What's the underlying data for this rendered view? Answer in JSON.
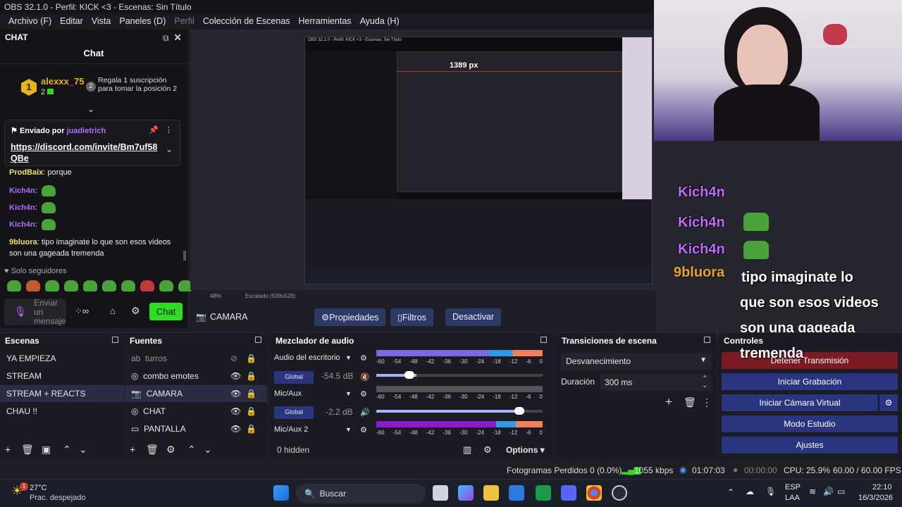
{
  "window": {
    "title": "OBS 32.1.0 - Perfil: KICK <3 - Escenas: Sin Título"
  },
  "menu": [
    {
      "label": "Archivo (F)",
      "disabled": false
    },
    {
      "label": "Editar",
      "disabled": false
    },
    {
      "label": "Vista",
      "disabled": false
    },
    {
      "label": "Paneles (D)",
      "disabled": false
    },
    {
      "label": "Perfil",
      "disabled": true
    },
    {
      "label": "Colección de Escenas",
      "disabled": false
    },
    {
      "label": "Herramientas",
      "disabled": false
    },
    {
      "label": "Ayuda (H)",
      "disabled": false
    }
  ],
  "chat": {
    "dock_title": "CHAT",
    "title": "Chat",
    "leader": {
      "rank": "1",
      "name": "alexxx_75",
      "count": "2",
      "rank2": "2",
      "promo": "Regala 1 suscripción para tomar la posición 2"
    },
    "pinned": {
      "label": "Enviado por",
      "user": "juadietrich",
      "link": "https://discord.com/invite/Bm7uf58QBe",
      "link_line1": "https://discord.com/invite/Bm7uf58",
      "link_line2": "QBe"
    },
    "messages": [
      {
        "user": "ProdBaix",
        "text": "porque"
      },
      {
        "user": "Kich4n",
        "text": ""
      },
      {
        "user": "Kich4n",
        "text": ""
      },
      {
        "user": "Kich4n",
        "text": ""
      },
      {
        "user": "9bluora",
        "text": "tipo imaginate lo que son esos videos son una gageada tremenda"
      }
    ],
    "msg5_line1": "tipo imaginate lo que son esos videos",
    "msg5_line2": "son una gageada tremenda",
    "followers": "Solo seguidores",
    "input_placeholder": "Enviar un mensaje",
    "send_label": "Chat"
  },
  "preview": {
    "inner_title": "OBS 32.1.0 - Perfil: KICK <3 - Escenas: Sin Título",
    "px_label": "1389 px",
    "zoom": "48%",
    "scale": "Escalado (939x528)"
  },
  "overlay": {
    "kich_name": "Kich4n",
    "msg_user": "9bluora",
    "msg_lines": [
      "tipo imaginate lo",
      "que son esos videos",
      "son una gageada",
      "tremenda"
    ]
  },
  "source_bar": {
    "source": "CAMARA",
    "properties": "Propiedades",
    "filters": "Filtros",
    "deactivate": "Desactivar"
  },
  "scenes": {
    "title": "Escenas",
    "items": [
      {
        "label": "YA EMPIEZA",
        "selected": false
      },
      {
        "label": "STREAM",
        "selected": false
      },
      {
        "label": "STREAM + REACTS",
        "selected": true
      },
      {
        "label": "CHAU !!",
        "selected": false
      }
    ]
  },
  "sources": {
    "title": "Fuentes",
    "items": [
      {
        "label": "turros",
        "icon": "text-icon",
        "hidden": true
      },
      {
        "label": "combo emotes",
        "icon": "browser-icon",
        "hidden": false
      },
      {
        "label": "CAMARA",
        "icon": "camera-icon",
        "hidden": false
      },
      {
        "label": "CHAT",
        "icon": "browser-icon",
        "hidden": false
      },
      {
        "label": "PANTALLA",
        "icon": "display-icon",
        "hidden": false
      }
    ]
  },
  "mixer": {
    "title": "Mezclador de audio",
    "channels": [
      {
        "name": "Audio del escritorio",
        "track": "Global",
        "db": "-54.5 dB",
        "muted": true
      },
      {
        "name": "Mic/Aux",
        "track": "Global",
        "db": "-2.2 dB",
        "muted": false
      },
      {
        "name": "Mic/Aux 2",
        "track": "",
        "db": "",
        "muted": false
      }
    ],
    "ticks": [
      "-60",
      "-54",
      "-48",
      "-42",
      "-36",
      "-30",
      "-24",
      "-18",
      "-12",
      "-6",
      "0"
    ],
    "hidden": "0 hidden",
    "options": "Options"
  },
  "transitions": {
    "title": "Transiciones de escena",
    "selected": "Desvanecimiento",
    "duration_label": "Duración",
    "duration": "300 ms"
  },
  "controls": {
    "title": "Controles",
    "buttons": [
      "Detener Transmisión",
      "Iniciar Grabación",
      "Iniciar Cámara Virtual",
      "Modo Estudio",
      "Ajustes"
    ]
  },
  "status": {
    "dropped": "Fotogramas Perdidos 0 (0.0%)",
    "kbps": "1055 kbps",
    "stream_time": "01:07:03",
    "rec_time": "00:00:00",
    "cpu": "CPU: 25.9%",
    "fps": "60.00 / 60.00 FPS"
  },
  "taskbar": {
    "temp": "27°C",
    "weather": "Prac. despejado",
    "badge": "1",
    "search": "Buscar",
    "lang1": "ESP",
    "lang2": "LAA",
    "time": "22:10",
    "date": "16/3/2026"
  },
  "colors": {
    "accent": "#2a3580",
    "kick_green": "#2fdc24",
    "selected_scene": "#2a2c45",
    "kich_purple": "#c06cff"
  }
}
